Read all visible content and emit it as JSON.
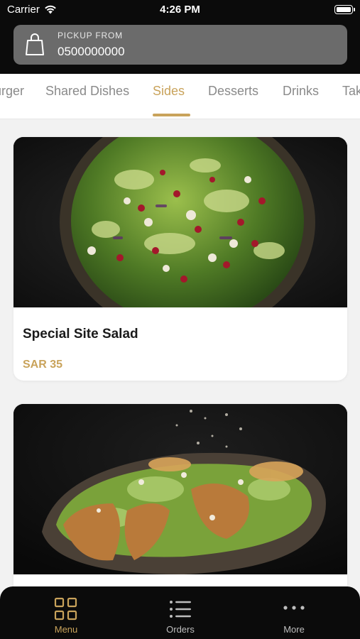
{
  "status_bar": {
    "carrier": "Carrier",
    "time": "4:26 PM"
  },
  "header": {
    "pickup_label": "PICKUP FROM",
    "pickup_value": "0500000000"
  },
  "tabs": [
    {
      "label": "Burger"
    },
    {
      "label": "Shared Dishes"
    },
    {
      "label": "Sides"
    },
    {
      "label": "Desserts"
    },
    {
      "label": "Drinks"
    },
    {
      "label": "Take"
    }
  ],
  "active_tab": "Sides",
  "items": [
    {
      "name": "Special Site Salad",
      "price": "SAR 35",
      "image": "salad-photo"
    },
    {
      "name": "",
      "price": "",
      "image": "caesar-salad-photo"
    }
  ],
  "bottom_nav": [
    {
      "label": "Menu",
      "icon": "grid-icon",
      "active": true
    },
    {
      "label": "Orders",
      "icon": "list-icon",
      "active": false
    },
    {
      "label": "More",
      "icon": "more-dots-icon",
      "active": false
    }
  ],
  "colors": {
    "accent": "#c9a35b",
    "header_bg": "#0b0b0b",
    "pickup_bg": "#6b6b6b"
  }
}
